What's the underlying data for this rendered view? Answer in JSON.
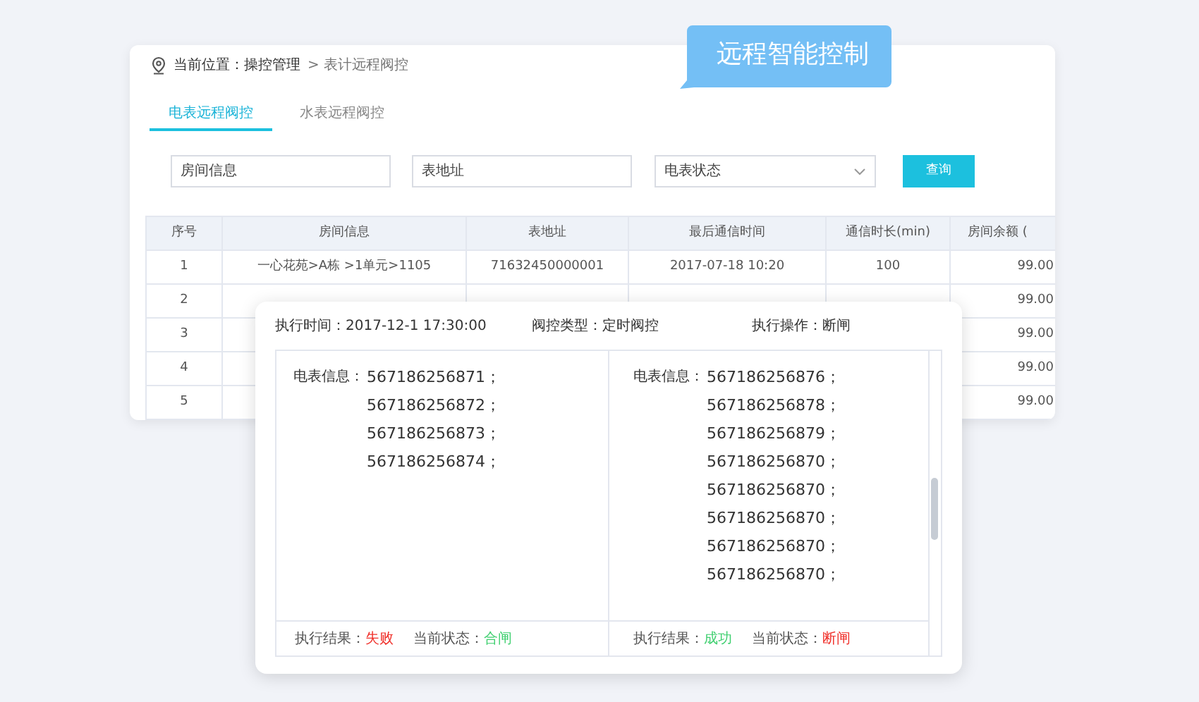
{
  "callout": {
    "title": "远程智能控制"
  },
  "breadcrumb": {
    "label": "当前位置：操控管理",
    "current": "> 表计远程阀控"
  },
  "tabs": [
    {
      "label": "电表远程阀控",
      "selected": true
    },
    {
      "label": "水表远程阀控",
      "selected": false
    }
  ],
  "filters": {
    "room": {
      "placeholder": "房间信息"
    },
    "address": {
      "placeholder": "表地址"
    },
    "status": {
      "placeholder": "电表状态"
    },
    "search_button": "查询"
  },
  "table": {
    "columns": [
      "序号",
      "房间信息",
      "表地址",
      "最后通信时间",
      "通信时长(min)",
      "房间余额 ("
    ],
    "rows": [
      {
        "no": "1",
        "room": "一心花苑>A栋 >1单元>1105",
        "address": "71632450000001",
        "time": "2017-07-18 10:20",
        "duration": "100",
        "balance": "99.00"
      },
      {
        "no": "2",
        "balance": "99.00"
      },
      {
        "no": "3",
        "balance": "99.00"
      },
      {
        "no": "4",
        "balance": "99.00"
      },
      {
        "no": "5",
        "balance": "99.00"
      }
    ]
  },
  "popup": {
    "exec_time": "执行时间：2017-12-1 17:30:00",
    "valve_type": "阀控类型：定时阀控",
    "operation": "执行操作：断闸",
    "groups": [
      {
        "label": "电表信息：",
        "meters": [
          "567186256871；",
          "567186256872；",
          "567186256873；",
          "567186256874；"
        ],
        "result_label": "执行结果：",
        "result": "失败",
        "success": false,
        "state_label": "当前状态：",
        "state": "合闸",
        "closed": true
      },
      {
        "label": "电表信息：",
        "meters": [
          "567186256876；",
          "567186256878；",
          "567186256879；",
          "567186256870；",
          "567186256870；",
          "567186256870；",
          "567186256870；",
          "567186256870；"
        ],
        "result_label": "执行结果：",
        "result": "成功",
        "success": true,
        "state_label": "当前状态：",
        "state": "断闸",
        "closed": false
      }
    ]
  }
}
